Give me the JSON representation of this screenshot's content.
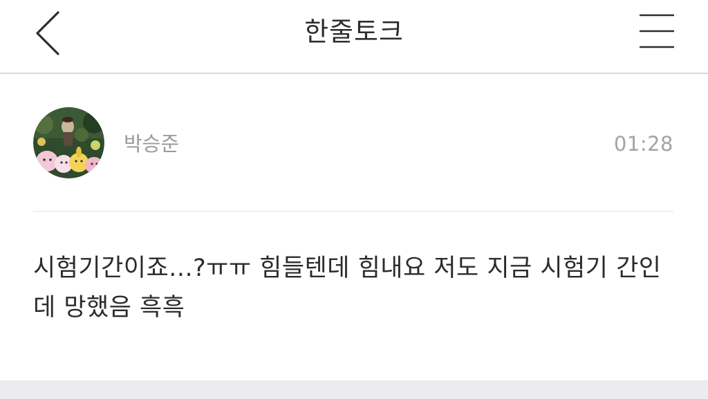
{
  "header": {
    "title": "한줄토크",
    "back_icon": "chevron-left-icon",
    "menu_icon": "hamburger-menu-icon"
  },
  "post": {
    "author": "박승준",
    "time": "01:28",
    "avatar_icon": "cartoon-character-avatar",
    "content": "시험기간이죠...?ㅠㅠ 힘들텐데 힘내요 저도 지금 시험기 간인데 망했음 흑흑"
  },
  "colors": {
    "header_divider": "#d9d9d9",
    "muted_text": "#9a9a9a",
    "body_text": "#2b2b2b",
    "footer_band": "#ececf0"
  }
}
